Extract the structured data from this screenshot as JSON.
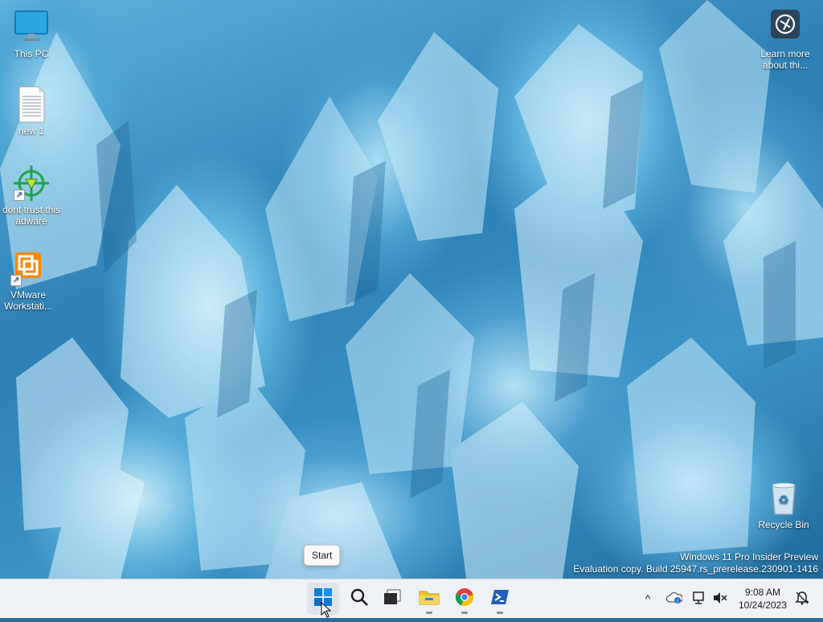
{
  "desktop": {
    "icons_left": [
      {
        "label": "This PC",
        "icon": "monitor-icon"
      },
      {
        "label": "new 1",
        "icon": "text-document-icon"
      },
      {
        "label": "dont trust this adware",
        "icon": "crosshair-app-icon"
      },
      {
        "label": "VMware Workstati...",
        "icon": "vmware-icon"
      }
    ],
    "learn_more": {
      "label": "Learn more about thi...",
      "icon": "camera-info-icon"
    },
    "recycle_bin": {
      "label": "Recycle Bin",
      "icon": "recycle-bin-icon"
    }
  },
  "watermark": {
    "line1": "Windows 11 Pro Insider Preview",
    "line2": "Evaluation copy. Build 25947.rs_prerelease.230901-1416"
  },
  "tooltip": {
    "text": "Start"
  },
  "taskbar": {
    "buttons": [
      {
        "name": "Start",
        "icon": "windows-logo-icon"
      },
      {
        "name": "Search",
        "icon": "search-icon"
      },
      {
        "name": "Task View",
        "icon": "task-view-icon"
      },
      {
        "name": "File Explorer",
        "icon": "folder-icon"
      },
      {
        "name": "Google Chrome",
        "icon": "chrome-icon"
      },
      {
        "name": "PowerShell",
        "icon": "powershell-icon"
      }
    ],
    "tray": {
      "chevron": "^",
      "time": "9:08 AM",
      "date": "10/24/2023"
    }
  },
  "colors": {
    "taskbar_bg": "#eef1f6",
    "start_blue": "#0078d4",
    "folder_yellow": "#f2c12e",
    "powershell_blue": "#1f5fb8"
  }
}
